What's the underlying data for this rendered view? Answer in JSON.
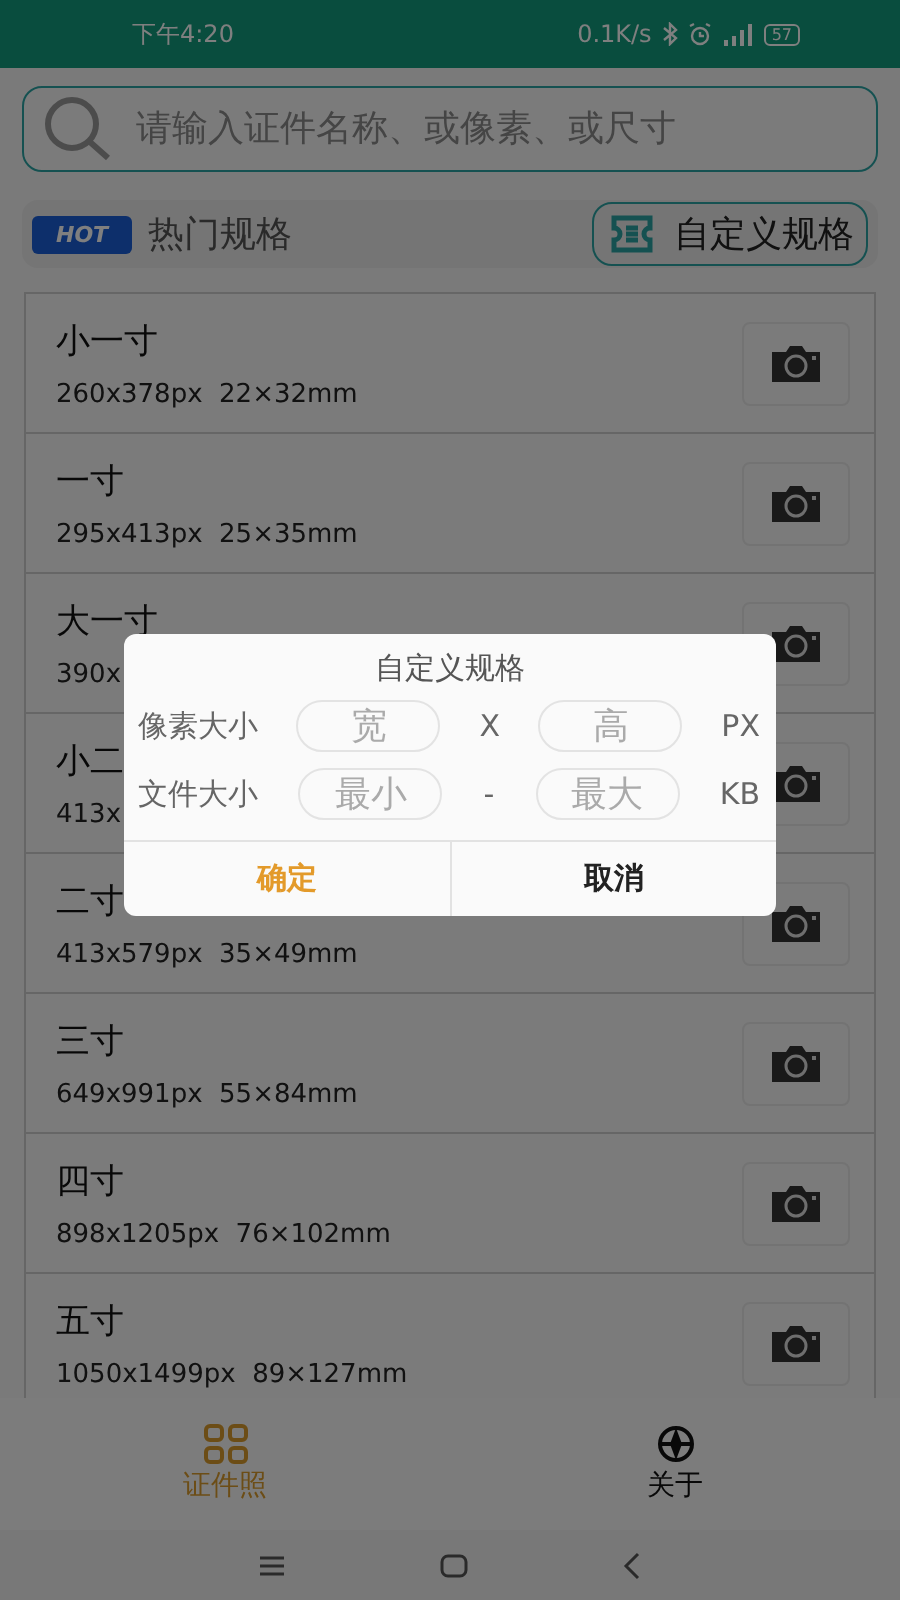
{
  "status_bar": {
    "time": "下午4:20",
    "speed": "0.1K/s",
    "battery": "57"
  },
  "search": {
    "placeholder": "请输入证件名称、或像素、或尺寸"
  },
  "section": {
    "badge": "HOT",
    "title": "热门规格",
    "custom_button": "自定义规格"
  },
  "specs": [
    {
      "name": "小一寸",
      "size": "260x378px  22×32mm"
    },
    {
      "name": "一寸",
      "size": "295x413px  25×35mm"
    },
    {
      "name": "大一寸",
      "size": "390x"
    },
    {
      "name": "小二",
      "size": "413x"
    },
    {
      "name": "二寸",
      "size": "413x579px  35×49mm"
    },
    {
      "name": "三寸",
      "size": "649x991px  55×84mm"
    },
    {
      "name": "四寸",
      "size": "898x1205px  76×102mm"
    },
    {
      "name": "五寸",
      "size": "1050x1499px  89×127mm"
    }
  ],
  "dialog": {
    "title": "自定义规格",
    "rows": [
      {
        "label": "像素大小",
        "min_placeholder": "宽",
        "separator": "X",
        "max_placeholder": "高",
        "unit": "PX"
      },
      {
        "label": "文件大小",
        "min_placeholder": "最小",
        "separator": "-",
        "max_placeholder": "最大",
        "unit": "KB"
      }
    ],
    "buttons": [
      {
        "label": "确定",
        "kind": "confirm"
      },
      {
        "label": "取消",
        "kind": "cancel"
      }
    ]
  },
  "tabs": [
    {
      "label": "证件照",
      "kind": "grid",
      "selected": true
    },
    {
      "label": "关于",
      "kind": "compass",
      "selected": false
    }
  ]
}
